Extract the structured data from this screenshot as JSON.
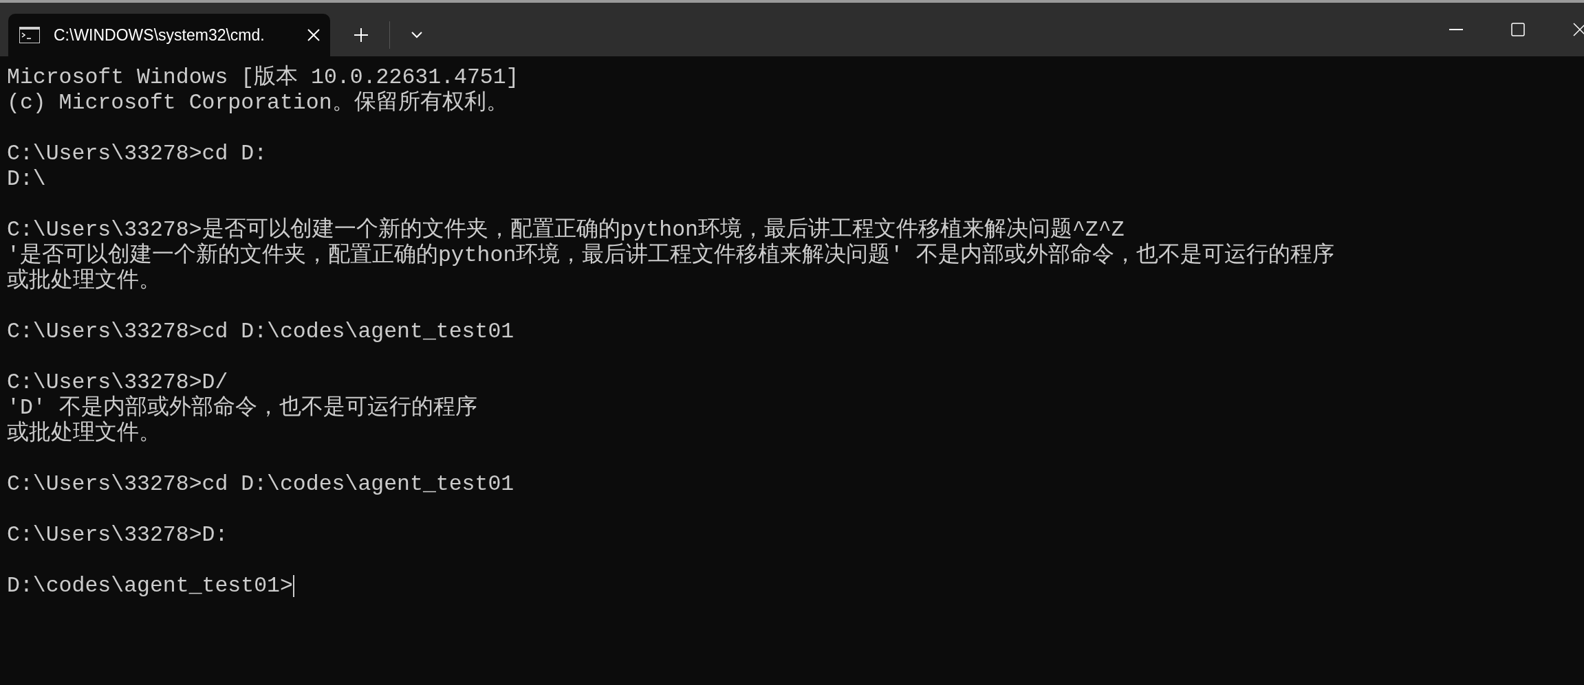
{
  "tabs": [
    {
      "title": "C:\\WINDOWS\\system32\\cmd.",
      "selected": true
    }
  ],
  "console": {
    "blocks": [
      [
        "Microsoft Windows [版本 10.0.22631.4751]",
        "(c) Microsoft Corporation。保留所有权利。"
      ],
      [
        "C:\\Users\\33278>cd D:",
        "D:\\"
      ],
      [
        "C:\\Users\\33278>是否可以创建一个新的文件夹，配置正确的python环境，最后讲工程文件移植来解决问题^Z^Z",
        "'是否可以创建一个新的文件夹，配置正确的python环境，最后讲工程文件移植来解决问题' 不是内部或外部命令，也不是可运行的程序",
        "或批处理文件。"
      ],
      [
        "C:\\Users\\33278>cd D:\\codes\\agent_test01"
      ],
      [
        "C:\\Users\\33278>D/",
        "'D' 不是内部或外部命令，也不是可运行的程序",
        "或批处理文件。"
      ],
      [
        "C:\\Users\\33278>cd D:\\codes\\agent_test01"
      ],
      [
        "C:\\Users\\33278>D:"
      ],
      [
        "D:\\codes\\agent_test01>"
      ]
    ],
    "cursor_visible": true
  }
}
